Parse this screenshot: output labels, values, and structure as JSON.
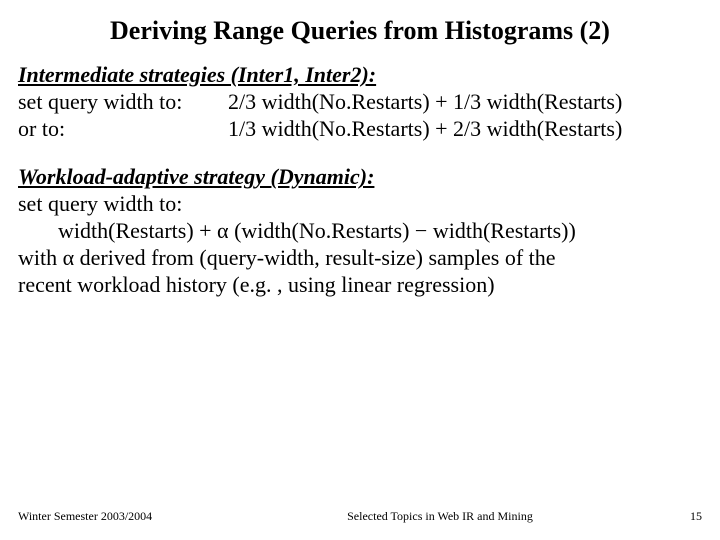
{
  "title": "Deriving Range Queries from Histograms (2)",
  "section1": {
    "heading": "Intermediate strategies (Inter1, Inter2):",
    "row1_label": "set query width to:",
    "row1_value": "2/3 width(No.Restarts) + 1/3 width(Restarts)",
    "row2_label": "or to:",
    "row2_value": "1/3 width(No.Restarts) + 2/3 width(Restarts)"
  },
  "section2": {
    "heading": "Workload-adaptive strategy (Dynamic):",
    "line1": "set query width to:",
    "line2": "width(Restarts) + α (width(No.Restarts) − width(Restarts))",
    "line3": "with α derived from (query-width, result-size) samples of the",
    "line4": "recent workload history (e.g. , using linear regression)"
  },
  "footer": {
    "left": "Winter Semester 2003/2004",
    "center": "Selected Topics in Web IR and Mining",
    "right": "15"
  }
}
